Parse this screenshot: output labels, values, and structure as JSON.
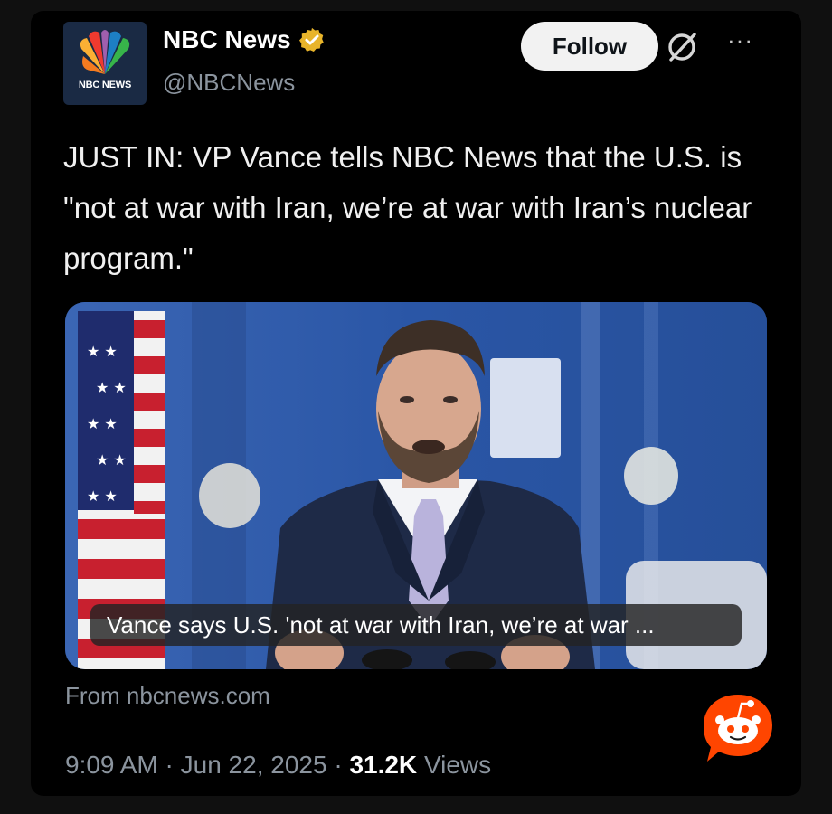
{
  "author": {
    "name": "NBC News",
    "handle": "@NBCNews",
    "avatar_text": "NBC NEWS",
    "verified": "gold-verified-icon"
  },
  "actions": {
    "follow_label": "Follow",
    "grok_icon": "grok-icon",
    "more_label": "···"
  },
  "tweet": {
    "text": "JUST IN: VP Vance tells NBC News that the U.S. is \"not at war with Iran, we’re at war with Iran’s nuclear program.\""
  },
  "media": {
    "caption": "Vance says U.S. 'not at war with Iran, we’re at war ...",
    "source": "From nbcnews.com"
  },
  "meta": {
    "time": "9:09 AM",
    "date": "Jun 22, 2025",
    "separator": "·",
    "views_count": "31.2K",
    "views_label": "Views"
  },
  "colors": {
    "background": "#000000",
    "verified_gold": "#e8b42a",
    "reddit_orange": "#ff4500",
    "media_blue": "#2c56a0"
  }
}
